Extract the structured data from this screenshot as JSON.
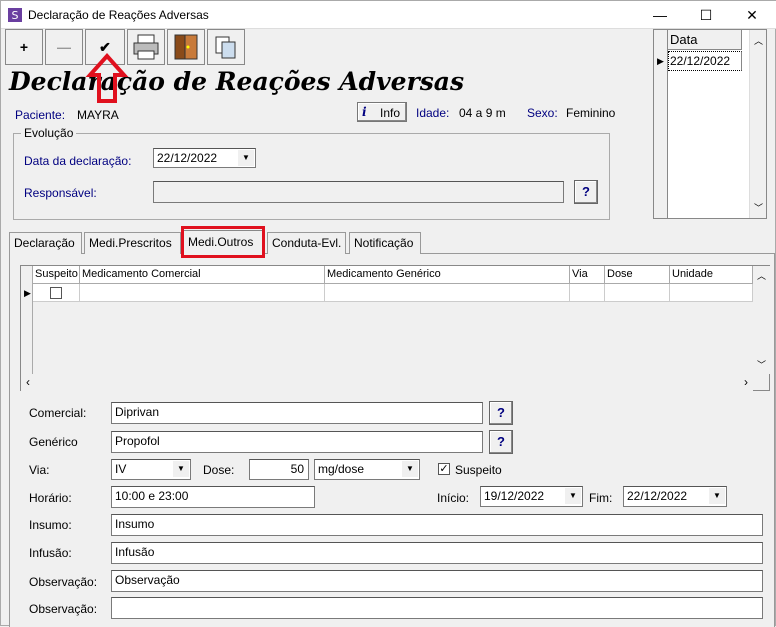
{
  "window": {
    "title": "Declaração de Reações Adversas",
    "minimize": "—",
    "maximize": "☐",
    "close": "✕"
  },
  "toolbar": {
    "add": "+",
    "remove": "—",
    "confirm": "✔"
  },
  "heading": "Declaração de Reações Adversas",
  "patient": {
    "paciente_label": "Paciente:",
    "paciente": "MAYRA",
    "info_label": "Info",
    "idade_label": "Idade:",
    "idade": "04 a 9 m",
    "sexo_label": "Sexo:",
    "sexo": "Feminino"
  },
  "evolucao": {
    "title": "Evolução",
    "data_label": "Data da declaração:",
    "data": "22/12/2022",
    "responsavel_label": "Responsável:",
    "responsavel": "",
    "help": "?"
  },
  "side_grid": {
    "header": "Data",
    "rows": [
      "22/12/2022"
    ]
  },
  "tabs": [
    "Declaração",
    "Medi.Prescritos",
    "Medi.Outros",
    "Conduta-Evl.",
    "Notificação"
  ],
  "grid": {
    "columns": [
      "Suspeito",
      "Medicamento Comercial",
      "Medicamento Genérico",
      "Via",
      "Dose",
      "Unidade"
    ]
  },
  "form": {
    "comercial_label": "Comercial:",
    "comercial": "Diprivan",
    "generico_label": "Genérico",
    "generico": "Propofol",
    "via_label": "Via:",
    "via": "IV",
    "dose_label": "Dose:",
    "dose": "50",
    "unidade": "mg/dose",
    "suspeito_label": "Suspeito",
    "horario_label": "Horário:",
    "horario": "10:00 e 23:00",
    "inicio_label": "Início:",
    "inicio": "19/12/2022",
    "fim_label": "Fim:",
    "fim": "22/12/2022",
    "insumo_label": "Insumo:",
    "insumo": "Insumo",
    "infusao_label": "Infusão:",
    "infusao": "Infusão",
    "observacao_label": "Observação:",
    "observacao": "Observação",
    "observacao2_label": "Observação:",
    "observacao2": "",
    "help": "?"
  },
  "colors": {
    "label_blue": "#000080",
    "highlight_red": "#e0101e"
  }
}
